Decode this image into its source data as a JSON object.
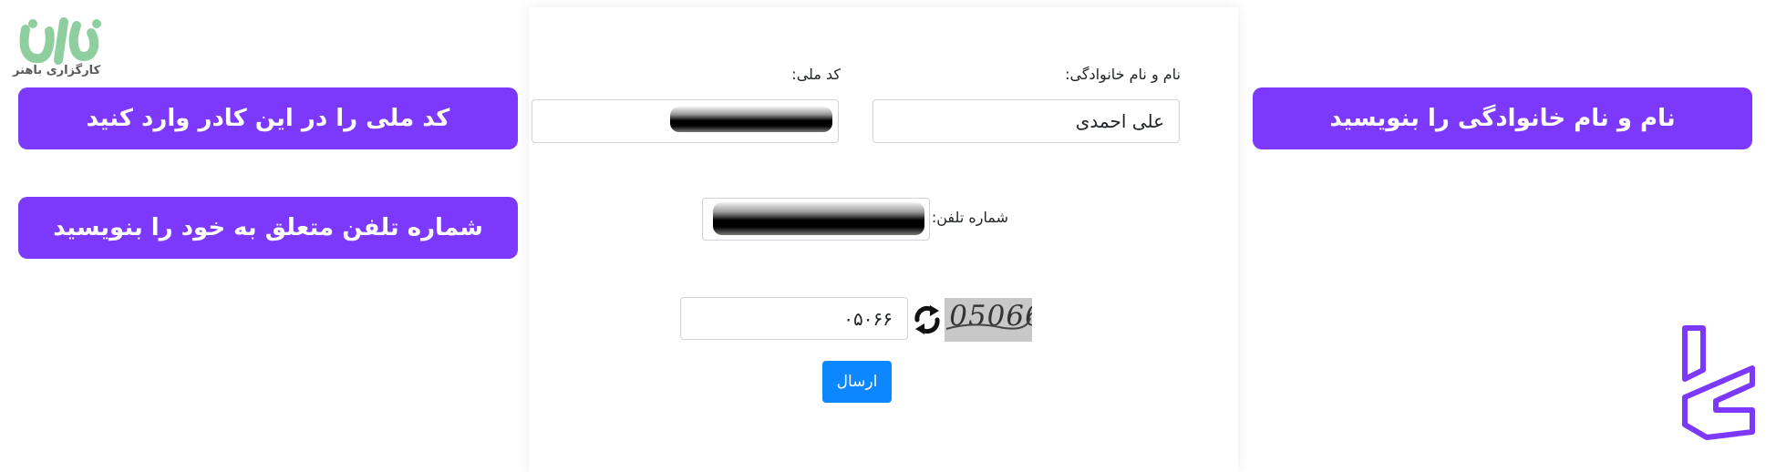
{
  "brand": {
    "caption": "کارگزاری باهنر",
    "logo_text": "ابم",
    "accent_color": "#7c39fb",
    "logo_color": "#8fcf9f"
  },
  "callouts": {
    "name": "نام و نام خانوادگی را بنویسید",
    "national_code": "کد ملی را در این کادر وارد کنید",
    "phone": "شماره تلفن متعلق به خود را بنویسید"
  },
  "form": {
    "name_label": "نام و نام خانوادگی:",
    "name_value": "علی احمدی",
    "national_code_label": "کد ملی:",
    "phone_label": "شماره تلفن:",
    "captcha_input_value": "۰۵۰۶۶",
    "captcha_image_text": "05066",
    "submit_label": "ارسال"
  }
}
